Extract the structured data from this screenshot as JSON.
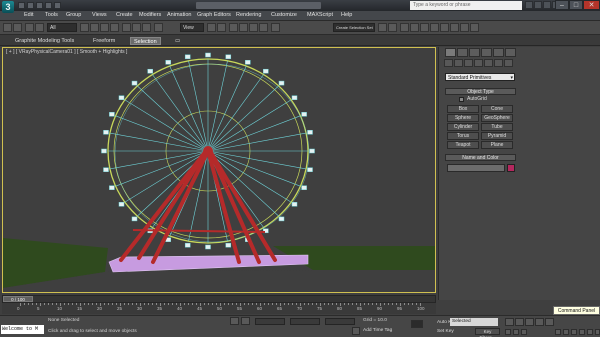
{
  "window": {
    "title_placeholder": "",
    "search_placeholder": "Type a keyword or phrase"
  },
  "menus": [
    "Edit",
    "Tools",
    "Group",
    "Views",
    "Create",
    "Modifiers",
    "Animation",
    "Graph Editors",
    "Rendering",
    "Customize",
    "MAXScript",
    "Help"
  ],
  "toolbar": {
    "filter_dropdown": "All",
    "view_dropdown": "View",
    "selection_set_dropdown": "Create Selection Set"
  },
  "ribbon": {
    "tabs": [
      "Graphite Modeling Tools",
      "Freeform",
      "Selection"
    ]
  },
  "viewport": {
    "label": "[ + ] [ VRayPhysicalCamera01 ] [ Smooth + Highlights ]"
  },
  "command_panel": {
    "category_dropdown": "Standard Primitives",
    "object_type_header": "Object Type",
    "autogrid_label": "AutoGrid",
    "object_buttons": [
      "Box",
      "Cone",
      "Sphere",
      "GeoSphere",
      "Cylinder",
      "Tube",
      "Torus",
      "Pyramid",
      "Teapot",
      "Plane"
    ],
    "name_color_header": "Name and Color",
    "swatch_color": "#b4285e"
  },
  "timeline": {
    "position_label": "0 / 100",
    "tick_labels": [
      "0",
      "5",
      "10",
      "15",
      "20",
      "25",
      "30",
      "35",
      "40",
      "45",
      "50",
      "55",
      "60",
      "65",
      "70",
      "75",
      "80",
      "85",
      "90",
      "95",
      "100"
    ]
  },
  "status": {
    "script_listener": "Welcome to M",
    "selection_status": "None Selected",
    "prompt": "Click and drag to select and move objects",
    "grid": "Grid = 10.0",
    "add_time_tag": "Add Time Tag",
    "auto_key": "Auto Key",
    "set_key": "Set Key",
    "key_mode_dropdown": "Selected",
    "key_filters": "Key Filters...",
    "tooltip": "Command Panel"
  },
  "colors": {
    "viewport_border": "#d0c050",
    "wheel_frame": "#b52a2a",
    "wheel_rim": "#c8d85a",
    "wheel_spokes": "#6fd3d8",
    "base_platform": "#c79be0",
    "ground": "#2f4a1e"
  }
}
